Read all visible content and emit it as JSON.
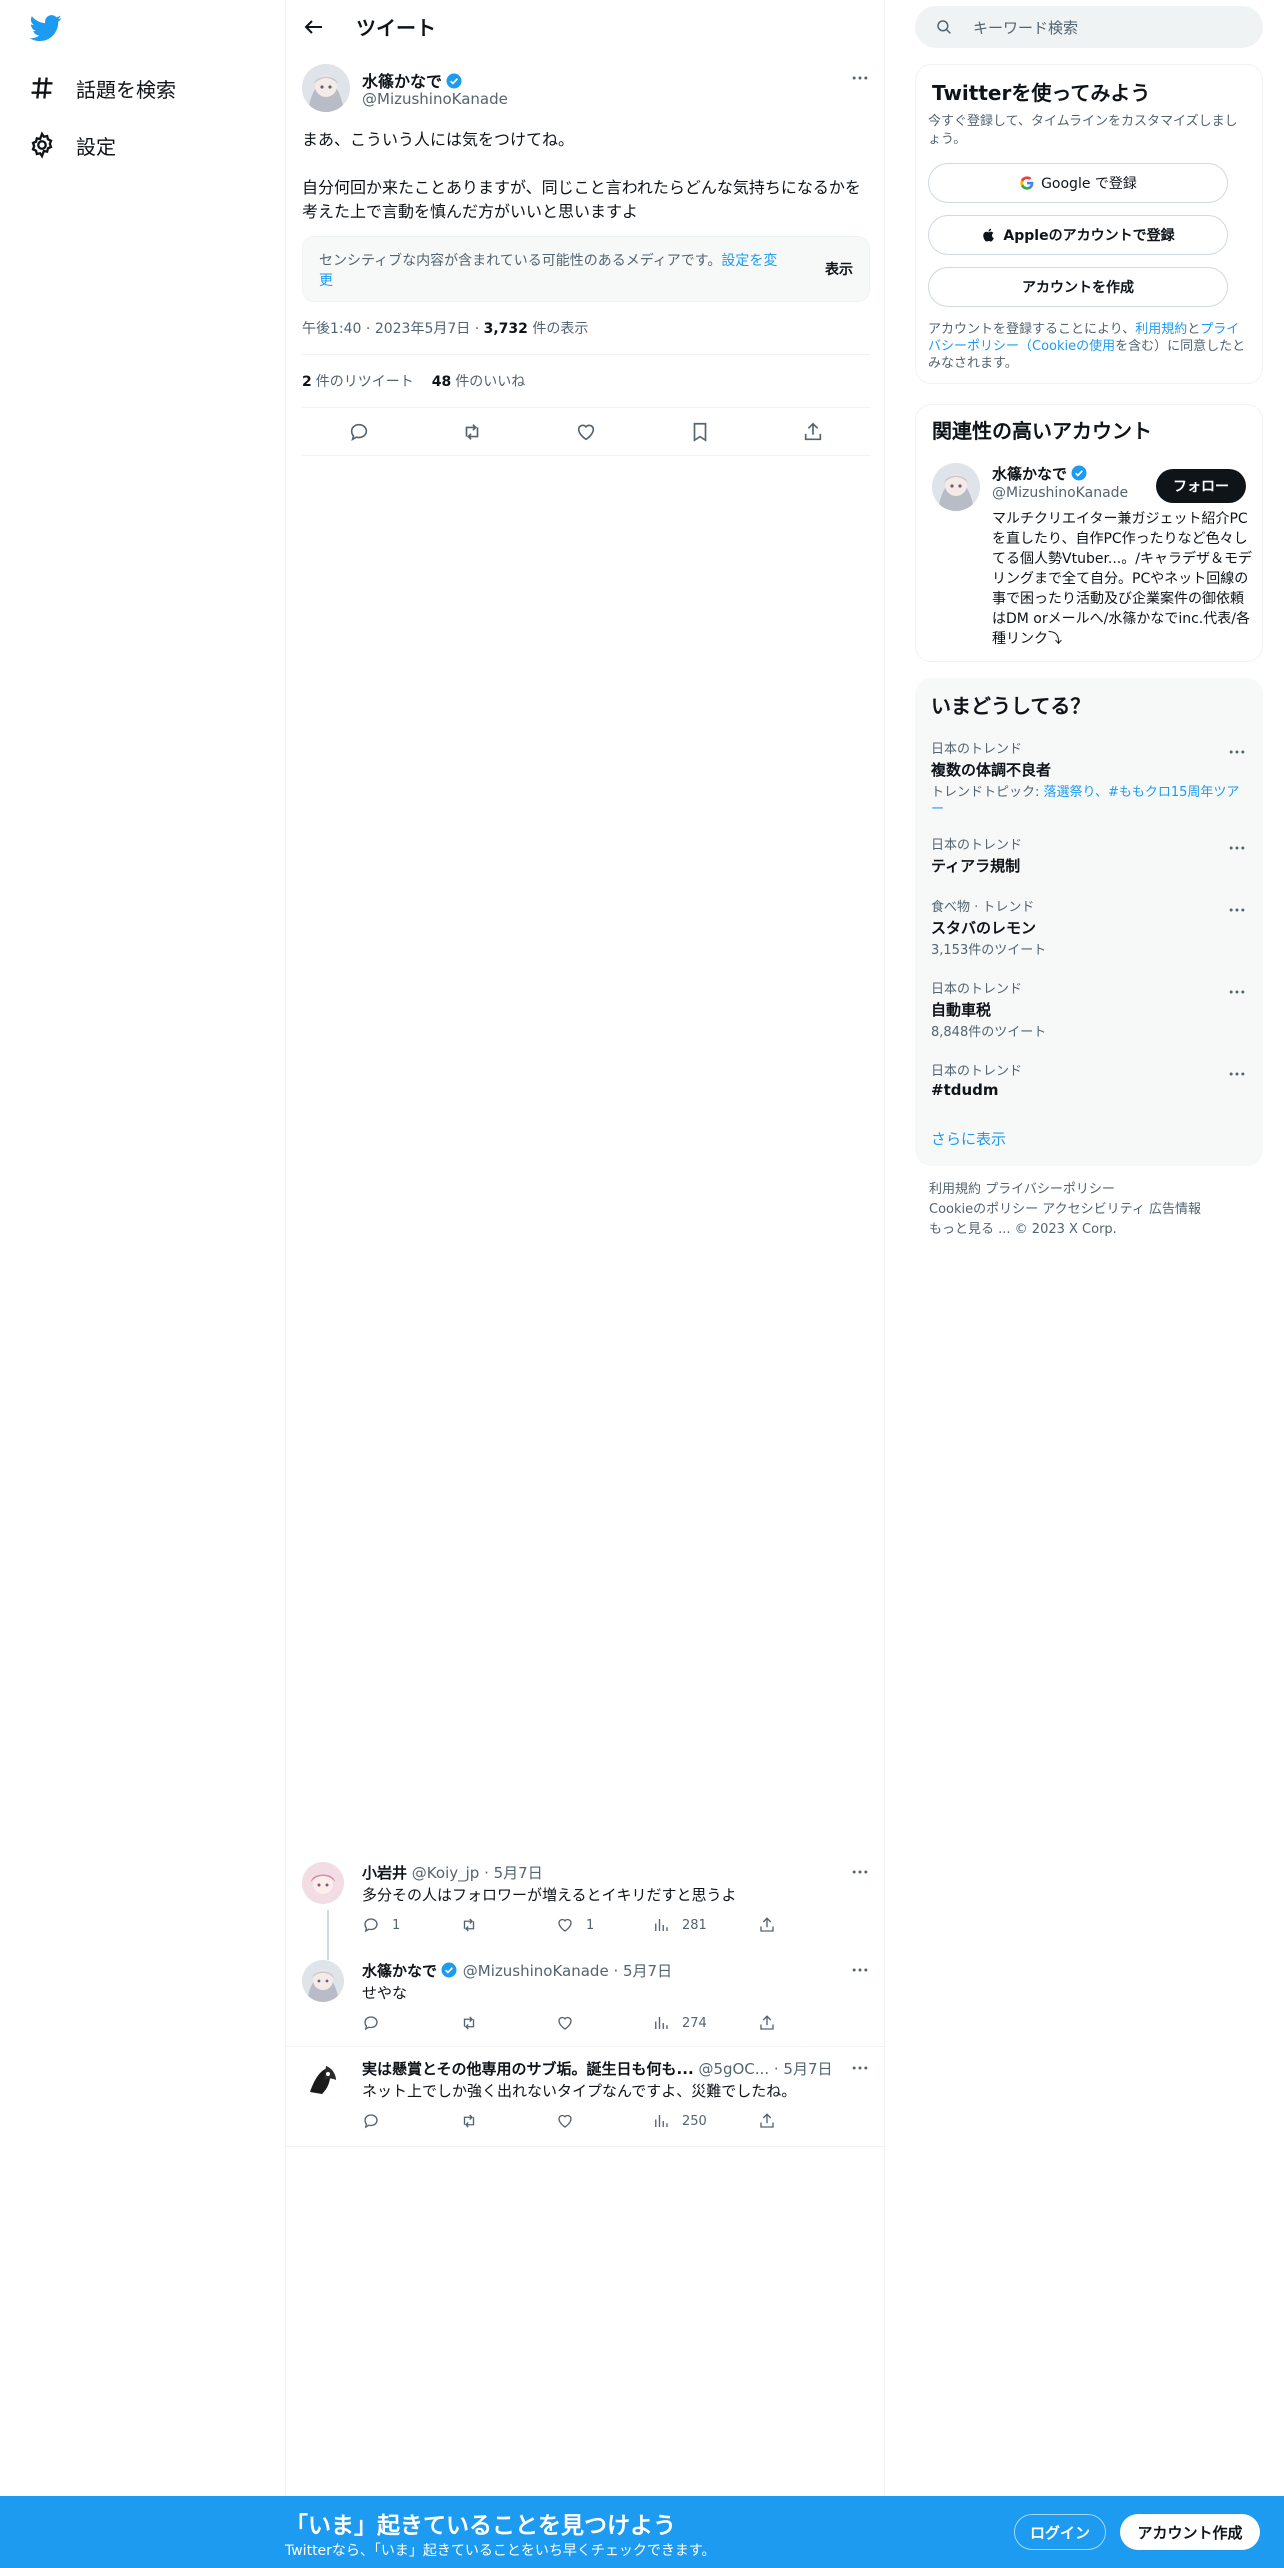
{
  "nav": {
    "logo_icon": "twitter-bird-icon",
    "explore_label": "話題を検索",
    "settings_label": "設定"
  },
  "header": {
    "title": "ツイート"
  },
  "tweet": {
    "author_name": "水篠かなで",
    "author_handle": "@MizushinoKanade",
    "text": "まあ、こういう人には気をつけてね。\n\n自分何回か来たことありますが、同じこと言われたらどんな気持ちになるかを考えた上で言動を慎んだ方がいいと思いますよ",
    "sensitive_notice": "センシティブな内容が含まれている可能性のあるメディアです。",
    "sensitive_link": "設定を変更",
    "show_label": "表示",
    "time": "午後1:40",
    "date": "2023年5月7日",
    "views_count": "3,732",
    "views_label": "件の表示",
    "retweets_count": "2",
    "retweets_label": "件のリツイート",
    "likes_count": "48",
    "likes_label": "件のいいね"
  },
  "replies": [
    {
      "name": "小岩井",
      "handle": "@Koiy_jp",
      "date": "· 5月7日",
      "text": "多分その人はフォロワーが増えるとイキリだすと思うよ",
      "reply_count": "1",
      "like_count": "1",
      "views": "281"
    },
    {
      "name": "水篠かなで",
      "handle": "@MizushinoKanade",
      "date": "· 5月7日",
      "text": "せやな",
      "views": "274"
    },
    {
      "name": "実は懸賞とその他専用のサブ垢。誕生日も何も...",
      "handle": "@5gOC...",
      "date": "· 5月7日",
      "text": "ネット上でしか強く出れないタイプなんですよ、災難でしたね。",
      "views": "250"
    }
  ],
  "search": {
    "placeholder": "キーワード検索"
  },
  "signup_panel": {
    "title": "Twitterを使ってみよう",
    "subtitle": "今すぐ登録して、タイムラインをカスタマイズしましょう。",
    "google_label": "Google で登録",
    "apple_label": "Appleのアカウントで登録",
    "create_label": "アカウントを作成",
    "terms_prefix": "アカウントを登録することにより、",
    "terms_link": "利用規約",
    "terms_and": "と",
    "privacy_link": "プライバシーポリシー（Cookieの使用",
    "terms_suffix": "を含む）に同意したとみなされます。"
  },
  "related": {
    "title": "関連性の高いアカウント",
    "name": "水篠かなで",
    "handle": "@MizushinoKanade",
    "follow_label": "フォロー",
    "bio": "マルチクリエイター兼ガジェット紹介PCを直したり、自作PC作ったりなど色々してる個人勢Vtuber...。/キャラデザ＆モデリングまで全て自分。PCやネット回線の事で困ったり活動及び企業案件の御依頼はDM orメールへ/水篠かなでinc.代表/各種リンク⤵"
  },
  "trends": {
    "title": "いまどうしてる？",
    "items": [
      {
        "category": "日本のトレンド",
        "name": "複数の体調不良者",
        "sub_prefix": "トレンドトピック: ",
        "sub_links": "落選祭り、#ももクロ15周年ツアー"
      },
      {
        "category": "日本のトレンド",
        "name": "ティアラ規制"
      },
      {
        "category": "食べ物 · トレンド",
        "name": "スタバのレモン",
        "count": "3,153件のツイート"
      },
      {
        "category": "日本のトレンド",
        "name": "自動車税",
        "count": "8,848件のツイート"
      },
      {
        "category": "日本のトレンド",
        "name": "#tdudm"
      }
    ],
    "show_more": "さらに表示"
  },
  "footer": {
    "line1": "利用規約   プライバシーポリシー",
    "line2": "Cookieのポリシー   アクセシビリティ   広告情報",
    "line3": "もっと見る ...   © 2023 X Corp."
  },
  "bottom_bar": {
    "headline": "「いま」起きていることを見つけよう",
    "subline": "Twitterなら、「いま」起きていることをいち早くチェックできます。",
    "login_label": "ログイン",
    "signup_label": "アカウント作成"
  },
  "colors": {
    "accent": "#1d9bf0",
    "text": "#0f1419",
    "muted": "#536471",
    "border": "#eff3f4"
  }
}
